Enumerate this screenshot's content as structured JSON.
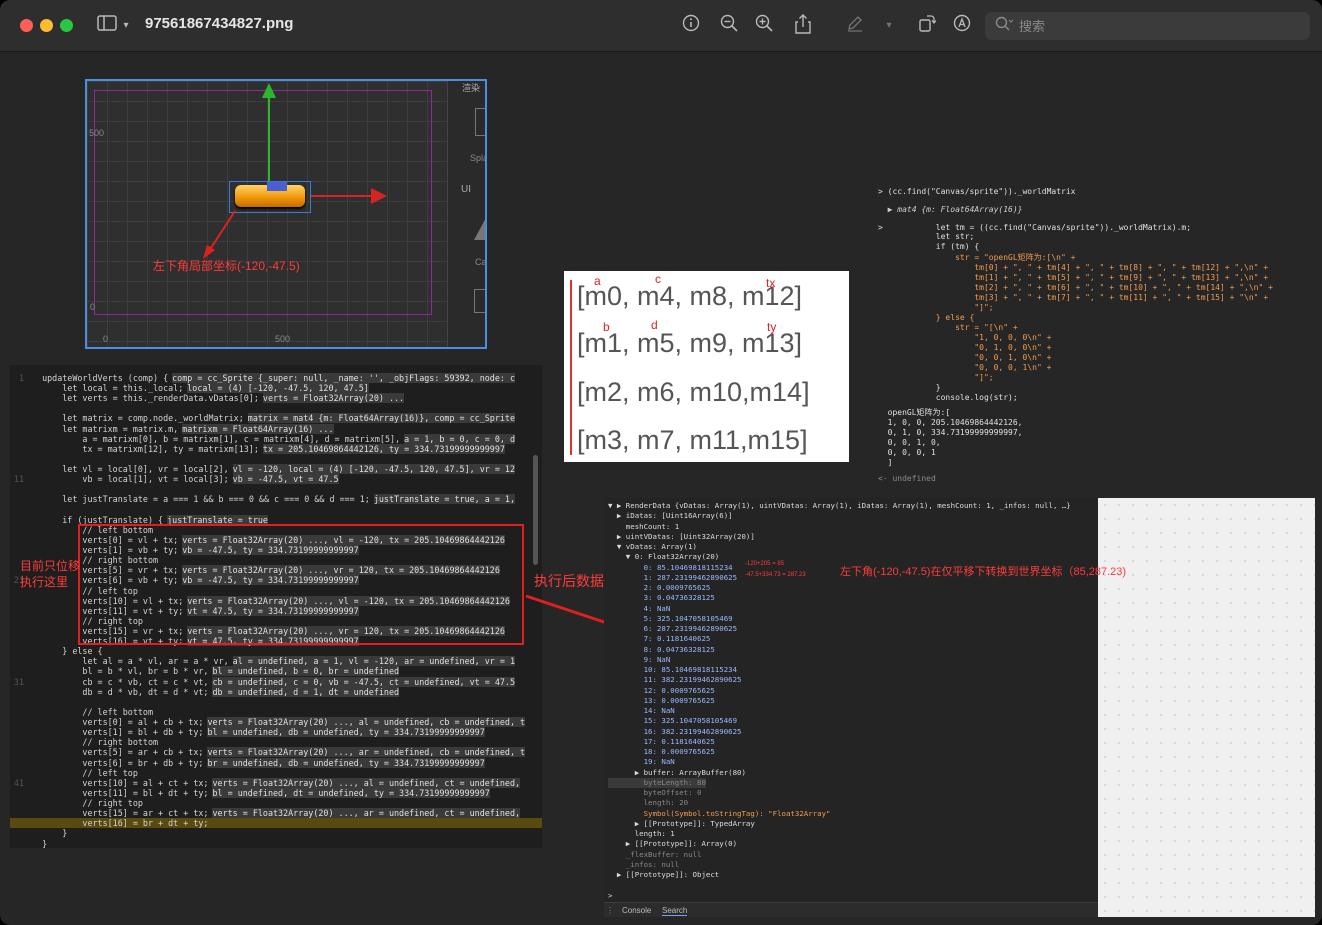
{
  "window": {
    "title": "97561867434827.png",
    "search_placeholder": "搜索",
    "toolbar_icons": [
      "sidebar-toggle-icon",
      "info-icon",
      "zoom-out-icon",
      "zoom-in-icon",
      "share-icon",
      "markup-pen-icon",
      "chevron-down-icon",
      "rotate-icon",
      "annotate-icon",
      "search-icon"
    ]
  },
  "scene": {
    "label_500_left": "500",
    "label_500_bottom": "500",
    "label_0_left": "0",
    "label_0_bottom": "0",
    "side_top": "渲染",
    "side_spla": "Spla",
    "side_ui": "UI",
    "side_ca": "Ca",
    "annotation": "左下角局部坐标(-120,-47.5)"
  },
  "code": {
    "lines": [
      {
        "t": "  updateWorldVerts (comp) {",
        "h": "comp = cc_Sprite {_super: null, _name: '', _objFlags: 59392, node: c"
      },
      {
        "t": "      let local = this._local;",
        "h": "local = (4) [-120, -47.5, 120, 47.5]"
      },
      {
        "t": "      let verts = this._renderData.vDatas[0];",
        "h": "verts = Float32Array(20) ..."
      },
      {
        "t": "",
        "h": ""
      },
      {
        "t": "      let matrix = comp.node._worldMatrix;",
        "h": "matrix = mat4 {m: Float64Array(16)}, comp = cc_Sprite"
      },
      {
        "t": "      let matrixm = matrix.m,",
        "h": "matrixm = Float64Array(16) ..."
      },
      {
        "t": "          a = matrixm[0], b = matrixm[1], c = matrixm[4], d = matrixm[5],",
        "h": "a = 1, b = 0, c = 0, d"
      },
      {
        "t": "          tx = matrixm[12], ty = matrixm[13];",
        "h": "tx = 205.10469864442126, ty = 334.73199999999997"
      },
      {
        "t": "",
        "h": ""
      },
      {
        "t": "      let vl = local[0], vr = local[2],",
        "h": "vl = -120, local = (4) [-120, -47.5, 120, 47.5], vr = 12"
      },
      {
        "t": "          vb = local[1], vt = local[3];",
        "h": "vb = -47.5, vt = 47.5"
      },
      {
        "t": "",
        "h": ""
      },
      {
        "t": "      let justTranslate = a === 1 && b === 0 && c === 0 && d === 1;",
        "h": "justTranslate = true, a = 1,"
      },
      {
        "t": "",
        "h": ""
      },
      {
        "t": "      if (justTranslate) {",
        "h": "justTranslate = true"
      },
      {
        "t": "          // left bottom",
        "h": ""
      },
      {
        "t": "          verts[0] = vl + tx;",
        "h": "verts = Float32Array(20) ..., vl = -120, tx = 205.10469864442126"
      },
      {
        "t": "          verts[1] = vb + ty;",
        "h": "vb = -47.5, ty = 334.73199999999997"
      },
      {
        "t": "          // right bottom",
        "h": ""
      },
      {
        "t": "          verts[5] = vr + tx;",
        "h": "verts = Float32Array(20) ..., vr = 120, tx = 205.10469864442126"
      },
      {
        "t": "          verts[6] = vb + ty;",
        "h": "vb = -47.5, ty = 334.73199999999997"
      },
      {
        "t": "          // left top",
        "h": ""
      },
      {
        "t": "          verts[10] = vl + tx;",
        "h": "verts = Float32Array(20) ..., vl = -120, tx = 205.10469864442126"
      },
      {
        "t": "          verts[11] = vt + ty;",
        "h": "vt = 47.5, ty = 334.73199999999997"
      },
      {
        "t": "          // right top",
        "h": ""
      },
      {
        "t": "          verts[15] = vr + tx;",
        "h": "verts = Float32Array(20) ..., vr = 120, tx = 205.10469864442126"
      },
      {
        "t": "          verts[16] = vt + ty;",
        "h": "vt = 47.5, ty = 334.73199999999997"
      },
      {
        "t": "      } else {",
        "h": ""
      },
      {
        "t": "          let al = a * vl, ar = a * vr,",
        "h": "al = undefined, a = 1, vl = -120, ar = undefined, vr = 1"
      },
      {
        "t": "          bl = b * vl, br = b * vr,",
        "h": "bl = undefined, b = 0, br = undefined"
      },
      {
        "t": "          cb = c * vb, ct = c * vt,",
        "h": "cb = undefined, c = 0, vb = -47.5, ct = undefined, vt = 47.5"
      },
      {
        "t": "          db = d * vb, dt = d * vt;",
        "h": "db = undefined, d = 1, dt = undefined"
      },
      {
        "t": "",
        "h": ""
      },
      {
        "t": "          // left bottom",
        "h": ""
      },
      {
        "t": "          verts[0] = al + cb + tx;",
        "h": "verts = Float32Array(20) ..., al = undefined, cb = undefined, t"
      },
      {
        "t": "          verts[1] = bl + db + ty;",
        "h": "bl = undefined, db = undefined, ty = 334.73199999999997"
      },
      {
        "t": "          // right bottom",
        "h": ""
      },
      {
        "t": "          verts[5] = ar + cb + tx;",
        "h": "verts = Float32Array(20) ..., ar = undefined, cb = undefined, t"
      },
      {
        "t": "          verts[6] = br + db + ty;",
        "h": "br = undefined, db = undefined, ty = 334.73199999999997"
      },
      {
        "t": "          // left top",
        "h": ""
      },
      {
        "t": "          verts[10] = al + ct + tx;",
        "h": "verts = Float32Array(20) ..., al = undefined, ct = undefined,"
      },
      {
        "t": "          verts[11] = bl + dt + ty;",
        "h": "bl = undefined, dt = undefined, ty = 334.73199999999997"
      },
      {
        "t": "          // right top",
        "h": ""
      },
      {
        "t": "          verts[15] = ar + ct + tx;",
        "h": "verts = Float32Array(20) ..., ar = undefined, ct = undefined,"
      },
      {
        "t": "          verts[16] = br + dt + ty;",
        "h": ""
      },
      {
        "t": "      }",
        "h": ""
      },
      {
        "t": "  }",
        "h": ""
      }
    ],
    "annotation_left": "目前只位移\n执行这里",
    "annotation_arrow": "执行后数据变成"
  },
  "matrix_image": {
    "rows": [
      "[m0, m4, m8, m12]",
      "[m1, m5, m9, m13]",
      "[m2, m6, m10,m14]",
      "[m3, m7, m11,m15]"
    ],
    "labels": [
      "a",
      "c",
      "tx",
      "b",
      "d",
      "ty"
    ]
  },
  "console_top": {
    "lines": [
      "> (cc.find(\"Canvas/sprite\"))._worldMatrix",
      "  ▶ mat4 {m: Float64Array(16)}",
      ">           let tm = ((cc.find(\"Canvas/sprite\"))._worldMatrix).m;",
      "            let str;",
      "            if (tm) {",
      "                str = \"openGL矩阵为:[\\n\" +",
      "                    tm[0] + \", \" + tm[4] + \", \" + tm[8] + \", \" + tm[12] + \",\\n\" +",
      "                    tm[1] + \", \" + tm[5] + \", \" + tm[9] + \", \" + tm[13] + \",\\n\" +",
      "                    tm[2] + \", \" + tm[6] + \", \" + tm[10] + \", \" + tm[14] + \",\\n\" +",
      "                    tm[3] + \", \" + tm[7] + \", \" + tm[11] + \", \" + tm[15] + \"\\n\" +",
      "                    \"]\";",
      "            } else {",
      "                str = \"[\\n\" +",
      "                    \"1, 0, 0, 0\\n\" +",
      "                    \"0, 1, 0, 0\\n\" +",
      "                    \"0, 0, 1, 0\\n\" +",
      "                    \"0, 0, 0, 1\\n\" +",
      "                    \"]\";",
      "            }",
      "            console.log(str);",
      "",
      "  openGL矩阵为:[",
      "  1, 0, 0, 205.10469864442126,",
      "  0, 1, 0, 334.73199999999997,",
      "  0, 0, 1, 0,",
      "  0, 0, 0, 1",
      "  ]",
      "",
      "<· undefined"
    ]
  },
  "devtools": {
    "lines": [
      "▼ ▶ RenderData {vDatas: Array(1), uintVDatas: Array(1), iDatas: Array(1), meshCount: 1, _infos: null, …}",
      "  ▶ iDatas: [Uint16Array(6)]",
      "    meshCount: 1",
      "  ▶ uintVDatas: [Uint32Array(20)]",
      "  ▼ vDatas: Array(1)",
      "    ▼ 0: Float32Array(20)",
      "        0: 85.10469818115234",
      "        1: 287.23199462890625",
      "        2: 0.0009765625",
      "        3: 0.04736328125",
      "        4: NaN",
      "        5: 325.1047058105469",
      "        6: 287.23199462890625",
      "        7: 0.1181640625",
      "        8: 0.04736328125",
      "        9: NaN",
      "        10: 85.10469818115234",
      "        11: 382.23199462890625",
      "        12: 0.0009765625",
      "        13: 0.0009765625",
      "        14: NaN",
      "        15: 325.1047058105469",
      "        16: 382.23199462890625",
      "        17: 0.1181640625",
      "        18: 0.0009765625",
      "        19: NaN",
      "      ▶ buffer: ArrayBuffer(80)",
      "        byteLength: 80",
      "        byteOffset: 0",
      "        length: 20",
      "        Symbol(Symbol.toStringTag): \"Float32Array\"",
      "      ▶ [[Prototype]]: TypedArray",
      "      length: 1",
      "    ▶ [[Prototype]]: Array(0)",
      "    _flexBuffer: null",
      "    _infos: null",
      "  ▶ [[Prototype]]: Object",
      "",
      ">"
    ],
    "calc_note_1": "-120+205 = 85",
    "calc_note_2": "-47.5+334.73 = 287.23",
    "annotation": "左下角(-120,-47.5)在仅平移下转换到世界坐标（85,287.23)",
    "tabs": [
      "Console",
      "Search"
    ]
  }
}
